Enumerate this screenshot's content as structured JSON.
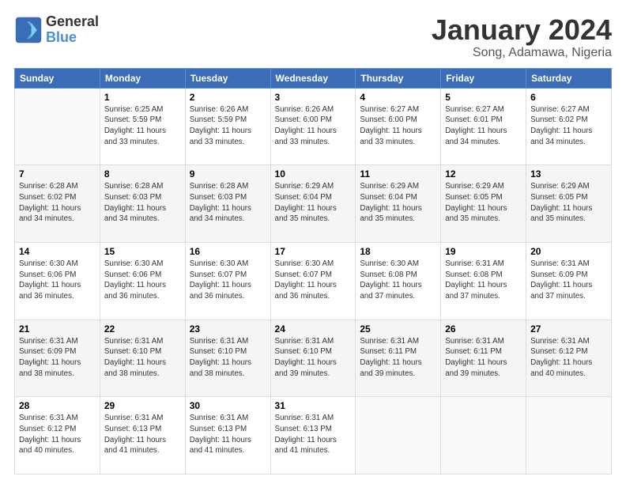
{
  "header": {
    "logo_general": "General",
    "logo_blue": "Blue",
    "month_title": "January 2024",
    "location": "Song, Adamawa, Nigeria"
  },
  "weekdays": [
    "Sunday",
    "Monday",
    "Tuesday",
    "Wednesday",
    "Thursday",
    "Friday",
    "Saturday"
  ],
  "weeks": [
    [
      {
        "day": "",
        "info": ""
      },
      {
        "day": "1",
        "info": "Sunrise: 6:25 AM\nSunset: 5:59 PM\nDaylight: 11 hours\nand 33 minutes."
      },
      {
        "day": "2",
        "info": "Sunrise: 6:26 AM\nSunset: 5:59 PM\nDaylight: 11 hours\nand 33 minutes."
      },
      {
        "day": "3",
        "info": "Sunrise: 6:26 AM\nSunset: 6:00 PM\nDaylight: 11 hours\nand 33 minutes."
      },
      {
        "day": "4",
        "info": "Sunrise: 6:27 AM\nSunset: 6:00 PM\nDaylight: 11 hours\nand 33 minutes."
      },
      {
        "day": "5",
        "info": "Sunrise: 6:27 AM\nSunset: 6:01 PM\nDaylight: 11 hours\nand 34 minutes."
      },
      {
        "day": "6",
        "info": "Sunrise: 6:27 AM\nSunset: 6:02 PM\nDaylight: 11 hours\nand 34 minutes."
      }
    ],
    [
      {
        "day": "7",
        "info": "Sunrise: 6:28 AM\nSunset: 6:02 PM\nDaylight: 11 hours\nand 34 minutes."
      },
      {
        "day": "8",
        "info": "Sunrise: 6:28 AM\nSunset: 6:03 PM\nDaylight: 11 hours\nand 34 minutes."
      },
      {
        "day": "9",
        "info": "Sunrise: 6:28 AM\nSunset: 6:03 PM\nDaylight: 11 hours\nand 34 minutes."
      },
      {
        "day": "10",
        "info": "Sunrise: 6:29 AM\nSunset: 6:04 PM\nDaylight: 11 hours\nand 35 minutes."
      },
      {
        "day": "11",
        "info": "Sunrise: 6:29 AM\nSunset: 6:04 PM\nDaylight: 11 hours\nand 35 minutes."
      },
      {
        "day": "12",
        "info": "Sunrise: 6:29 AM\nSunset: 6:05 PM\nDaylight: 11 hours\nand 35 minutes."
      },
      {
        "day": "13",
        "info": "Sunrise: 6:29 AM\nSunset: 6:05 PM\nDaylight: 11 hours\nand 35 minutes."
      }
    ],
    [
      {
        "day": "14",
        "info": "Sunrise: 6:30 AM\nSunset: 6:06 PM\nDaylight: 11 hours\nand 36 minutes."
      },
      {
        "day": "15",
        "info": "Sunrise: 6:30 AM\nSunset: 6:06 PM\nDaylight: 11 hours\nand 36 minutes."
      },
      {
        "day": "16",
        "info": "Sunrise: 6:30 AM\nSunset: 6:07 PM\nDaylight: 11 hours\nand 36 minutes."
      },
      {
        "day": "17",
        "info": "Sunrise: 6:30 AM\nSunset: 6:07 PM\nDaylight: 11 hours\nand 36 minutes."
      },
      {
        "day": "18",
        "info": "Sunrise: 6:30 AM\nSunset: 6:08 PM\nDaylight: 11 hours\nand 37 minutes."
      },
      {
        "day": "19",
        "info": "Sunrise: 6:31 AM\nSunset: 6:08 PM\nDaylight: 11 hours\nand 37 minutes."
      },
      {
        "day": "20",
        "info": "Sunrise: 6:31 AM\nSunset: 6:09 PM\nDaylight: 11 hours\nand 37 minutes."
      }
    ],
    [
      {
        "day": "21",
        "info": "Sunrise: 6:31 AM\nSunset: 6:09 PM\nDaylight: 11 hours\nand 38 minutes."
      },
      {
        "day": "22",
        "info": "Sunrise: 6:31 AM\nSunset: 6:10 PM\nDaylight: 11 hours\nand 38 minutes."
      },
      {
        "day": "23",
        "info": "Sunrise: 6:31 AM\nSunset: 6:10 PM\nDaylight: 11 hours\nand 38 minutes."
      },
      {
        "day": "24",
        "info": "Sunrise: 6:31 AM\nSunset: 6:10 PM\nDaylight: 11 hours\nand 39 minutes."
      },
      {
        "day": "25",
        "info": "Sunrise: 6:31 AM\nSunset: 6:11 PM\nDaylight: 11 hours\nand 39 minutes."
      },
      {
        "day": "26",
        "info": "Sunrise: 6:31 AM\nSunset: 6:11 PM\nDaylight: 11 hours\nand 39 minutes."
      },
      {
        "day": "27",
        "info": "Sunrise: 6:31 AM\nSunset: 6:12 PM\nDaylight: 11 hours\nand 40 minutes."
      }
    ],
    [
      {
        "day": "28",
        "info": "Sunrise: 6:31 AM\nSunset: 6:12 PM\nDaylight: 11 hours\nand 40 minutes."
      },
      {
        "day": "29",
        "info": "Sunrise: 6:31 AM\nSunset: 6:13 PM\nDaylight: 11 hours\nand 41 minutes."
      },
      {
        "day": "30",
        "info": "Sunrise: 6:31 AM\nSunset: 6:13 PM\nDaylight: 11 hours\nand 41 minutes."
      },
      {
        "day": "31",
        "info": "Sunrise: 6:31 AM\nSunset: 6:13 PM\nDaylight: 11 hours\nand 41 minutes."
      },
      {
        "day": "",
        "info": ""
      },
      {
        "day": "",
        "info": ""
      },
      {
        "day": "",
        "info": ""
      }
    ]
  ]
}
